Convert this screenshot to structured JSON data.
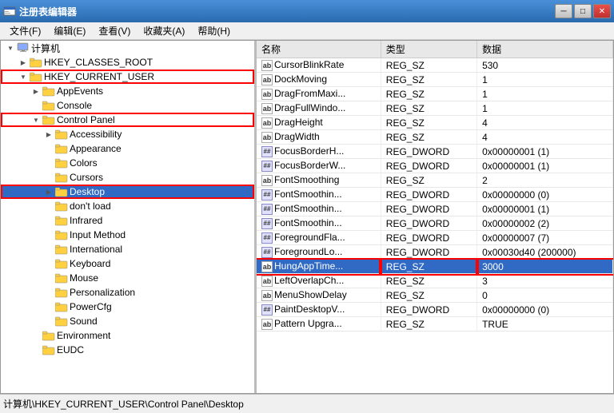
{
  "window": {
    "title": "注册表编辑器",
    "icon": "🗒"
  },
  "menu": {
    "items": [
      "文件(F)",
      "编辑(E)",
      "查看(V)",
      "收藏夹(A)",
      "帮助(H)"
    ]
  },
  "tree": {
    "items": [
      {
        "id": "computer",
        "label": "计算机",
        "indent": 1,
        "expanded": true,
        "hasExpand": true,
        "expandChar": "▲",
        "type": "computer"
      },
      {
        "id": "hkcr",
        "label": "HKEY_CLASSES_ROOT",
        "indent": 2,
        "expanded": false,
        "hasExpand": true,
        "expandChar": "▶",
        "type": "folder"
      },
      {
        "id": "hkcu",
        "label": "HKEY_CURRENT_USER",
        "indent": 2,
        "expanded": true,
        "hasExpand": true,
        "expandChar": "▼",
        "type": "folder",
        "boxed": true
      },
      {
        "id": "appevents",
        "label": "AppEvents",
        "indent": 3,
        "expanded": false,
        "hasExpand": true,
        "expandChar": "▶",
        "type": "folder"
      },
      {
        "id": "console",
        "label": "Console",
        "indent": 3,
        "expanded": false,
        "hasExpand": false,
        "type": "folder"
      },
      {
        "id": "controlpanel",
        "label": "Control Panel",
        "indent": 3,
        "expanded": true,
        "hasExpand": true,
        "expandChar": "▼",
        "type": "folder",
        "boxed": true
      },
      {
        "id": "accessibility",
        "label": "Accessibility",
        "indent": 4,
        "expanded": false,
        "hasExpand": true,
        "expandChar": "▶",
        "type": "folder"
      },
      {
        "id": "appearance",
        "label": "Appearance",
        "indent": 4,
        "expanded": false,
        "hasExpand": false,
        "type": "folder"
      },
      {
        "id": "colors",
        "label": "Colors",
        "indent": 4,
        "expanded": false,
        "hasExpand": false,
        "type": "folder"
      },
      {
        "id": "cursors",
        "label": "Cursors",
        "indent": 4,
        "expanded": false,
        "hasExpand": false,
        "type": "folder"
      },
      {
        "id": "desktop",
        "label": "Desktop",
        "indent": 4,
        "expanded": false,
        "hasExpand": true,
        "expandChar": "▶",
        "type": "folder",
        "boxed": true,
        "selected": true
      },
      {
        "id": "dontload",
        "label": "don't load",
        "indent": 4,
        "expanded": false,
        "hasExpand": false,
        "type": "folder"
      },
      {
        "id": "infrared",
        "label": "Infrared",
        "indent": 4,
        "expanded": false,
        "hasExpand": false,
        "type": "folder"
      },
      {
        "id": "inputmethod",
        "label": "Input Method",
        "indent": 4,
        "expanded": false,
        "hasExpand": false,
        "type": "folder"
      },
      {
        "id": "international",
        "label": "International",
        "indent": 4,
        "expanded": false,
        "hasExpand": false,
        "type": "folder"
      },
      {
        "id": "keyboard",
        "label": "Keyboard",
        "indent": 4,
        "expanded": false,
        "hasExpand": false,
        "type": "folder"
      },
      {
        "id": "mouse",
        "label": "Mouse",
        "indent": 4,
        "expanded": false,
        "hasExpand": false,
        "type": "folder"
      },
      {
        "id": "personalization",
        "label": "Personalization",
        "indent": 4,
        "expanded": false,
        "hasExpand": false,
        "type": "folder"
      },
      {
        "id": "powercfg",
        "label": "PowerCfg",
        "indent": 4,
        "expanded": false,
        "hasExpand": false,
        "type": "folder"
      },
      {
        "id": "sound",
        "label": "Sound",
        "indent": 4,
        "expanded": false,
        "hasExpand": false,
        "type": "folder"
      },
      {
        "id": "environment",
        "label": "Environment",
        "indent": 3,
        "expanded": false,
        "hasExpand": false,
        "type": "folder"
      },
      {
        "id": "eudc",
        "label": "EUDC",
        "indent": 3,
        "expanded": false,
        "hasExpand": false,
        "type": "folder"
      }
    ]
  },
  "table": {
    "headers": [
      "名称",
      "类型",
      "数据"
    ],
    "rows": [
      {
        "name": "CursorBlinkRate",
        "type": "REG_SZ",
        "data": "530",
        "typeIcon": "ab",
        "selected": false
      },
      {
        "name": "DockMoving",
        "type": "REG_SZ",
        "data": "1",
        "typeIcon": "ab",
        "selected": false
      },
      {
        "name": "DragFromMaxi...",
        "type": "REG_SZ",
        "data": "1",
        "typeIcon": "ab",
        "selected": false
      },
      {
        "name": "DragFullWindo...",
        "type": "REG_SZ",
        "data": "1",
        "typeIcon": "ab",
        "selected": false
      },
      {
        "name": "DragHeight",
        "type": "REG_SZ",
        "data": "4",
        "typeIcon": "ab",
        "selected": false
      },
      {
        "name": "DragWidth",
        "type": "REG_SZ",
        "data": "4",
        "typeIcon": "ab",
        "selected": false
      },
      {
        "name": "FocusBorderH...",
        "type": "REG_DWORD",
        "data": "0x00000001 (1)",
        "typeIcon": "dword",
        "selected": false
      },
      {
        "name": "FocusBorderW...",
        "type": "REG_DWORD",
        "data": "0x00000001 (1)",
        "typeIcon": "dword",
        "selected": false
      },
      {
        "name": "FontSmoothing",
        "type": "REG_SZ",
        "data": "2",
        "typeIcon": "ab",
        "selected": false
      },
      {
        "name": "FontSmoothin...",
        "type": "REG_DWORD",
        "data": "0x00000000 (0)",
        "typeIcon": "dword",
        "selected": false
      },
      {
        "name": "FontSmoothin...",
        "type": "REG_DWORD",
        "data": "0x00000001 (1)",
        "typeIcon": "dword",
        "selected": false
      },
      {
        "name": "FontSmoothin...",
        "type": "REG_DWORD",
        "data": "0x00000002 (2)",
        "typeIcon": "dword",
        "selected": false
      },
      {
        "name": "ForegroundFla...",
        "type": "REG_DWORD",
        "data": "0x00000007 (7)",
        "typeIcon": "dword",
        "selected": false
      },
      {
        "name": "ForegroundLo...",
        "type": "REG_DWORD",
        "data": "0x00030d40 (200000)",
        "typeIcon": "dword",
        "selected": false
      },
      {
        "name": "HungAppTime...",
        "type": "REG_SZ",
        "data": "3000",
        "typeIcon": "ab",
        "selected": true,
        "highlighted": true
      },
      {
        "name": "LeftOverlapCh...",
        "type": "REG_SZ",
        "data": "3",
        "typeIcon": "ab",
        "selected": false
      },
      {
        "name": "MenuShowDelay",
        "type": "REG_SZ",
        "data": "0",
        "typeIcon": "ab",
        "selected": false
      },
      {
        "name": "PaintDesktopV...",
        "type": "REG_DWORD",
        "data": "0x00000000 (0)",
        "typeIcon": "dword",
        "selected": false
      },
      {
        "name": "Pattern Upgra...",
        "type": "REG_SZ",
        "data": "TRUE",
        "typeIcon": "ab",
        "selected": false
      }
    ]
  },
  "statusBar": {
    "text": "计算机\\HKEY_CURRENT_USER\\Control Panel\\Desktop"
  }
}
